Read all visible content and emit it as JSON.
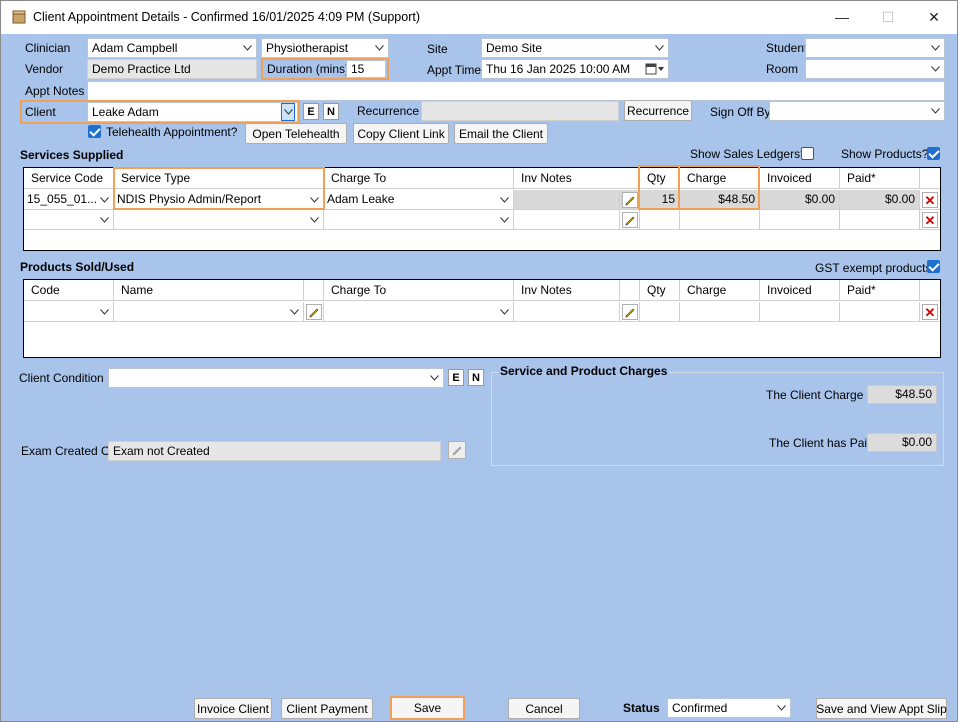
{
  "window": {
    "title": "Client Appointment Details - Confirmed 16/01/2025 4:09 PM (Support)"
  },
  "form": {
    "clinician_label": "Clinician",
    "clinician_value": "Adam Campbell",
    "profession_value": "Physiotherapist",
    "site_label": "Site",
    "site_value": "Demo Site",
    "student_label": "Student",
    "student_value": "",
    "vendor_label": "Vendor",
    "vendor_value": "Demo Practice Ltd",
    "duration_label": "Duration (mins)",
    "duration_value": "15",
    "appt_time_label": "Appt Time",
    "appt_time_value": "Thu  16 Jan  2025 10:00 AM",
    "room_label": "Room",
    "room_value": "",
    "appt_notes_label": "Appt Notes",
    "appt_notes_value": "",
    "client_label": "Client",
    "client_value": "Leake Adam",
    "e_button": "E",
    "n_button": "N",
    "recurrence_label": "Recurrence",
    "recurrence_value": "",
    "recurrence_button": "Recurrence",
    "sign_off_label": "Sign Off By",
    "sign_off_value": "",
    "telehealth_label": "Telehealth Appointment?",
    "open_telehealth": "Open Telehealth",
    "copy_client_link": "Copy Client Link",
    "email_client": "Email the Client"
  },
  "services": {
    "title": "Services Supplied",
    "show_sales_ledgers": "Show Sales Ledgers?",
    "show_products": "Show Products?",
    "columns": [
      "Service Code",
      "Service Type",
      "Charge To",
      "Inv Notes",
      "Qty",
      "Charge",
      "Invoiced",
      "Paid*"
    ],
    "row": {
      "code": "15_055_01...",
      "type": "NDIS Physio Admin/Report",
      "charge_to": "Adam Leake",
      "inv_notes": "",
      "qty": "15",
      "charge": "$48.50",
      "invoiced": "$0.00",
      "paid": "$0.00"
    }
  },
  "products": {
    "title": "Products Sold/Used",
    "gst_exempt": "GST exempt products",
    "columns": [
      "Code",
      "Name",
      "Charge To",
      "Inv Notes",
      "Qty",
      "Charge",
      "Invoiced",
      "Paid*"
    ]
  },
  "condition": {
    "client_condition_label": "Client Condition",
    "client_condition_value": "",
    "exam_created_label": "Exam Created On",
    "exam_created_value": "Exam not Created"
  },
  "charges": {
    "title": "Service and Product Charges",
    "client_charge_label": "The Client Charge is",
    "client_charge_value": "$48.50",
    "client_paid_label": "The Client has Paid",
    "client_paid_value": "$0.00"
  },
  "footer": {
    "invoice_client": "Invoice Client",
    "client_payment": "Client Payment",
    "save": "Save",
    "cancel": "Cancel",
    "status_label": "Status",
    "status_value": "Confirmed",
    "save_view_slip": "Save and View Appt Slip"
  },
  "colors": {
    "background": "#a9c4eb",
    "highlight": "#f0a155",
    "checkbox": "#1e6fd0",
    "delete": "#d40000"
  }
}
